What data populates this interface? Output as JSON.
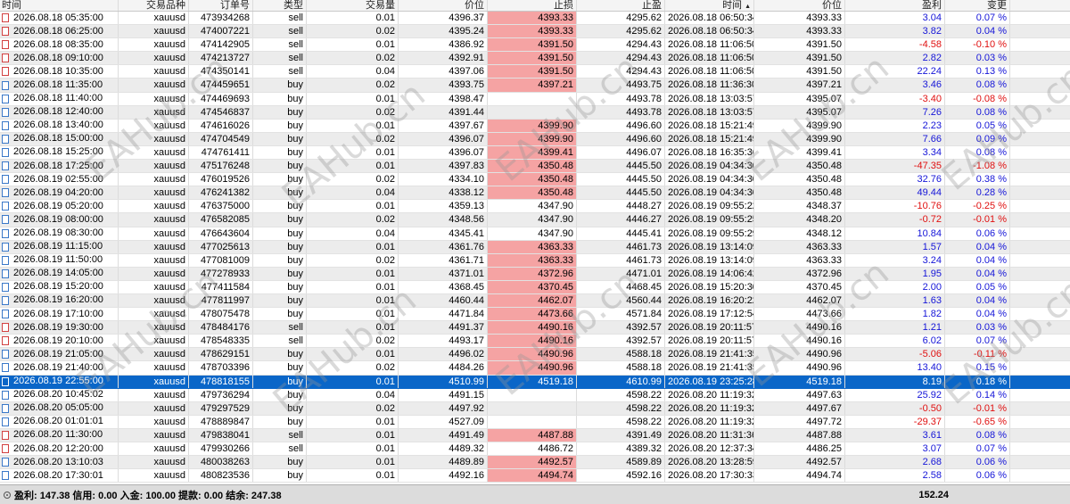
{
  "headers": [
    "时间",
    "交易品种",
    "订单号",
    "类型",
    "交易量",
    "价位",
    "止损",
    "止盈",
    "时间",
    "价位",
    "盈利",
    "变更"
  ],
  "sorted_column_indicator": "▲",
  "rows": [
    [
      "2026.08.18 05:35:00",
      "xauusd",
      "473934268",
      "sell",
      "0.01",
      "4396.37",
      "4393.33",
      "4295.62",
      "2026.08.18 06:50:34",
      "4393.33",
      "3.04",
      "0.07 %"
    ],
    [
      "2026.08.18 06:25:00",
      "xauusd",
      "474007221",
      "sell",
      "0.02",
      "4395.24",
      "4393.33",
      "4295.62",
      "2026.08.18 06:50:34",
      "4393.33",
      "3.82",
      "0.04 %"
    ],
    [
      "2026.08.18 08:35:00",
      "xauusd",
      "474142905",
      "sell",
      "0.01",
      "4386.92",
      "4391.50",
      "4294.43",
      "2026.08.18 11:06:50",
      "4391.50",
      "-4.58",
      "-0.10 %"
    ],
    [
      "2026.08.18 09:10:00",
      "xauusd",
      "474213727",
      "sell",
      "0.02",
      "4392.91",
      "4391.50",
      "4294.43",
      "2026.08.18 11:06:50",
      "4391.50",
      "2.82",
      "0.03 %"
    ],
    [
      "2026.08.18 10:35:00",
      "xauusd",
      "474350141",
      "sell",
      "0.04",
      "4397.06",
      "4391.50",
      "4294.43",
      "2026.08.18 11:06:50",
      "4391.50",
      "22.24",
      "0.13 %"
    ],
    [
      "2026.08.18 11:35:00",
      "xauusd",
      "474459651",
      "buy",
      "0.02",
      "4393.75",
      "4397.21",
      "4493.75",
      "2026.08.18 11:36:30",
      "4397.21",
      "3.46",
      "0.08 %"
    ],
    [
      "2026.08.18 11:40:00",
      "xauusd",
      "474469693",
      "buy",
      "0.01",
      "4398.47",
      "",
      "4493.78",
      "2026.08.18 13:03:57",
      "4395.07",
      "-3.40",
      "-0.08 %"
    ],
    [
      "2026.08.18 12:40:00",
      "xauusd",
      "474546837",
      "buy",
      "0.02",
      "4391.44",
      "",
      "4493.78",
      "2026.08.18 13:03:57",
      "4395.07",
      "7.26",
      "0.08 %"
    ],
    [
      "2026.08.18 13:40:00",
      "xauusd",
      "474616026",
      "buy",
      "0.01",
      "4397.67",
      "4399.90",
      "4496.60",
      "2026.08.18 15:21:49",
      "4399.90",
      "2.23",
      "0.05 %"
    ],
    [
      "2026.08.18 15:00:00",
      "xauusd",
      "474704549",
      "buy",
      "0.02",
      "4396.07",
      "4399.90",
      "4496.60",
      "2026.08.18 15:21:49",
      "4399.90",
      "7.66",
      "0.09 %"
    ],
    [
      "2026.08.18 15:25:00",
      "xauusd",
      "474761411",
      "buy",
      "0.01",
      "4396.07",
      "4399.41",
      "4496.07",
      "2026.08.18 16:35:36",
      "4399.41",
      "3.34",
      "0.08 %"
    ],
    [
      "2026.08.18 17:25:00",
      "xauusd",
      "475176248",
      "buy",
      "0.01",
      "4397.83",
      "4350.48",
      "4445.50",
      "2026.08.19 04:34:30",
      "4350.48",
      "-47.35",
      "-1.08 %"
    ],
    [
      "2026.08.19 02:55:00",
      "xauusd",
      "476019526",
      "buy",
      "0.02",
      "4334.10",
      "4350.48",
      "4445.50",
      "2026.08.19 04:34:30",
      "4350.48",
      "32.76",
      "0.38 %"
    ],
    [
      "2026.08.19 04:20:00",
      "xauusd",
      "476241382",
      "buy",
      "0.04",
      "4338.12",
      "4350.48",
      "4445.50",
      "2026.08.19 04:34:30",
      "4350.48",
      "49.44",
      "0.28 %"
    ],
    [
      "2026.08.19 05:20:00",
      "xauusd",
      "476375000",
      "buy",
      "0.01",
      "4359.13",
      "4347.90",
      "4448.27",
      "2026.08.19 09:55:22",
      "4348.37",
      "-10.76",
      "-0.25 %"
    ],
    [
      "2026.08.19 08:00:00",
      "xauusd",
      "476582085",
      "buy",
      "0.02",
      "4348.56",
      "4347.90",
      "4446.27",
      "2026.08.19 09:55:25",
      "4348.20",
      "-0.72",
      "-0.01 %"
    ],
    [
      "2026.08.19 08:30:00",
      "xauusd",
      "476643604",
      "buy",
      "0.04",
      "4345.41",
      "4347.90",
      "4445.41",
      "2026.08.19 09:55:29",
      "4348.12",
      "10.84",
      "0.06 %"
    ],
    [
      "2026.08.19 11:15:00",
      "xauusd",
      "477025613",
      "buy",
      "0.01",
      "4361.76",
      "4363.33",
      "4461.73",
      "2026.08.19 13:14:09",
      "4363.33",
      "1.57",
      "0.04 %"
    ],
    [
      "2026.08.19 11:50:00",
      "xauusd",
      "477081009",
      "buy",
      "0.02",
      "4361.71",
      "4363.33",
      "4461.73",
      "2026.08.19 13:14:09",
      "4363.33",
      "3.24",
      "0.04 %"
    ],
    [
      "2026.08.19 14:05:00",
      "xauusd",
      "477278933",
      "buy",
      "0.01",
      "4371.01",
      "4372.96",
      "4471.01",
      "2026.08.19 14:06:42",
      "4372.96",
      "1.95",
      "0.04 %"
    ],
    [
      "2026.08.19 15:20:00",
      "xauusd",
      "477411584",
      "buy",
      "0.01",
      "4368.45",
      "4370.45",
      "4468.45",
      "2026.08.19 15:20:30",
      "4370.45",
      "2.00",
      "0.05 %"
    ],
    [
      "2026.08.19 16:20:00",
      "xauusd",
      "477811997",
      "buy",
      "0.01",
      "4460.44",
      "4462.07",
      "4560.44",
      "2026.08.19 16:20:22",
      "4462.07",
      "1.63",
      "0.04 %"
    ],
    [
      "2026.08.19 17:10:00",
      "xauusd",
      "478075478",
      "buy",
      "0.01",
      "4471.84",
      "4473.66",
      "4571.84",
      "2026.08.19 17:12:54",
      "4473.66",
      "1.82",
      "0.04 %"
    ],
    [
      "2026.08.19 19:30:00",
      "xauusd",
      "478484176",
      "sell",
      "0.01",
      "4491.37",
      "4490.16",
      "4392.57",
      "2026.08.19 20:11:57",
      "4490.16",
      "1.21",
      "0.03 %"
    ],
    [
      "2026.08.19 20:10:00",
      "xauusd",
      "478548335",
      "sell",
      "0.02",
      "4493.17",
      "4490.16",
      "4392.57",
      "2026.08.19 20:11:57",
      "4490.16",
      "6.02",
      "0.07 %"
    ],
    [
      "2026.08.19 21:05:00",
      "xauusd",
      "478629151",
      "buy",
      "0.01",
      "4496.02",
      "4490.96",
      "4588.18",
      "2026.08.19 21:41:35",
      "4490.96",
      "-5.06",
      "-0.11 %"
    ],
    [
      "2026.08.19 21:40:00",
      "xauusd",
      "478703396",
      "buy",
      "0.02",
      "4484.26",
      "4490.96",
      "4588.18",
      "2026.08.19 21:41:35",
      "4490.96",
      "13.40",
      "0.15 %"
    ],
    [
      "2026.08.19 22:55:00",
      "xauusd",
      "478818155",
      "buy",
      "0.01",
      "4510.99",
      "4519.18",
      "4610.99",
      "2026.08.19 23:25:28",
      "4519.18",
      "8.19",
      "0.18 %"
    ],
    [
      "2026.08.20 10:45:02",
      "xauusd",
      "479736294",
      "buy",
      "0.04",
      "4491.15",
      "",
      "4598.22",
      "2026.08.20 11:19:32",
      "4497.63",
      "25.92",
      "0.14 %"
    ],
    [
      "2026.08.20 05:05:00",
      "xauusd",
      "479297529",
      "buy",
      "0.02",
      "4497.92",
      "",
      "4598.22",
      "2026.08.20 11:19:32",
      "4497.67",
      "-0.50",
      "-0.01 %"
    ],
    [
      "2026.08.20 01:01:01",
      "xauusd",
      "478889847",
      "buy",
      "0.01",
      "4527.09",
      "",
      "4598.22",
      "2026.08.20 11:19:32",
      "4497.72",
      "-29.37",
      "-0.65 %"
    ],
    [
      "2026.08.20 11:30:00",
      "xauusd",
      "479838041",
      "sell",
      "0.01",
      "4491.49",
      "4487.88",
      "4391.49",
      "2026.08.20 11:31:36",
      "4487.88",
      "3.61",
      "0.08 %"
    ],
    [
      "2026.08.20 12:20:00",
      "xauusd",
      "479930266",
      "sell",
      "0.01",
      "4489.32",
      "4486.72",
      "4389.32",
      "2026.08.20 12:37:34",
      "4486.25",
      "3.07",
      "0.07 %"
    ],
    [
      "2026.08.20 13:10:03",
      "xauusd",
      "480038263",
      "buy",
      "0.01",
      "4489.89",
      "4492.57",
      "4589.89",
      "2026.08.20 13:28:59",
      "4492.57",
      "2.68",
      "0.06 %"
    ],
    [
      "2026.08.20 17:30:01",
      "xauusd",
      "480823536",
      "buy",
      "0.01",
      "4492.16",
      "4494.74",
      "4592.16",
      "2026.08.20 17:30:33",
      "4494.74",
      "2.58",
      "0.06 %"
    ]
  ],
  "highlighted_sl_rows": [
    0,
    1,
    2,
    3,
    4,
    5,
    8,
    9,
    10,
    11,
    12,
    13,
    17,
    18,
    19,
    20,
    21,
    22,
    23,
    24,
    25,
    26,
    31,
    33,
    34
  ],
  "selected_row": 27,
  "footer": {
    "summary": "盈利: 147.38  信用: 0.00  入金: 100.00  提款: 0.00  结余: 247.38",
    "total_profit": "152.24"
  },
  "watermark_text": "EAHub.cn",
  "colors": {
    "selected": "#0a66c8",
    "sl_highlight": "#f5a3a3",
    "profit": "#1515d8",
    "loss": "#e01010"
  }
}
